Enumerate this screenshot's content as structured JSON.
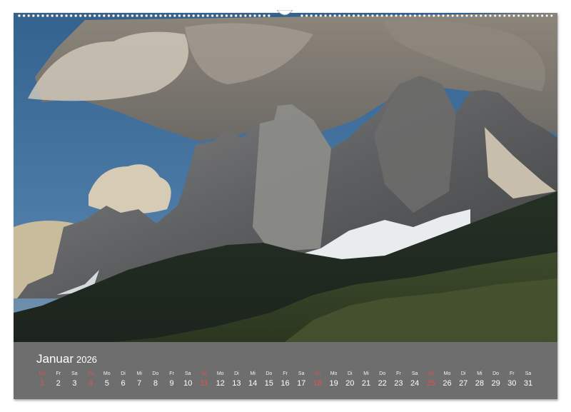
{
  "calendar": {
    "month": "Januar",
    "year": "2026",
    "days": [
      {
        "wd": "Do",
        "num": "1",
        "sunday": true
      },
      {
        "wd": "Fr",
        "num": "2"
      },
      {
        "wd": "Sa",
        "num": "3"
      },
      {
        "wd": "So",
        "num": "4",
        "sunday": true
      },
      {
        "wd": "Mo",
        "num": "5"
      },
      {
        "wd": "Di",
        "num": "6"
      },
      {
        "wd": "Mi",
        "num": "7"
      },
      {
        "wd": "Do",
        "num": "8"
      },
      {
        "wd": "Fr",
        "num": "9"
      },
      {
        "wd": "Sa",
        "num": "10"
      },
      {
        "wd": "So",
        "num": "11",
        "sunday": true
      },
      {
        "wd": "Mo",
        "num": "12"
      },
      {
        "wd": "Di",
        "num": "13"
      },
      {
        "wd": "Mi",
        "num": "14"
      },
      {
        "wd": "Do",
        "num": "15"
      },
      {
        "wd": "Fr",
        "num": "16"
      },
      {
        "wd": "Sa",
        "num": "17"
      },
      {
        "wd": "So",
        "num": "18",
        "sunday": true
      },
      {
        "wd": "Mo",
        "num": "19"
      },
      {
        "wd": "Di",
        "num": "20"
      },
      {
        "wd": "Mi",
        "num": "21"
      },
      {
        "wd": "Do",
        "num": "22"
      },
      {
        "wd": "Fr",
        "num": "23"
      },
      {
        "wd": "Sa",
        "num": "24"
      },
      {
        "wd": "So",
        "num": "25",
        "sunday": true
      },
      {
        "wd": "Mo",
        "num": "26"
      },
      {
        "wd": "Di",
        "num": "27"
      },
      {
        "wd": "Mi",
        "num": "28"
      },
      {
        "wd": "Do",
        "num": "29"
      },
      {
        "wd": "Fr",
        "num": "30"
      },
      {
        "wd": "Sa",
        "num": "31"
      }
    ]
  },
  "colors": {
    "bar": "#6e6e6e",
    "sunday": "#e05050",
    "sky": "#3f6f9f",
    "forest": "#2c3a26"
  }
}
